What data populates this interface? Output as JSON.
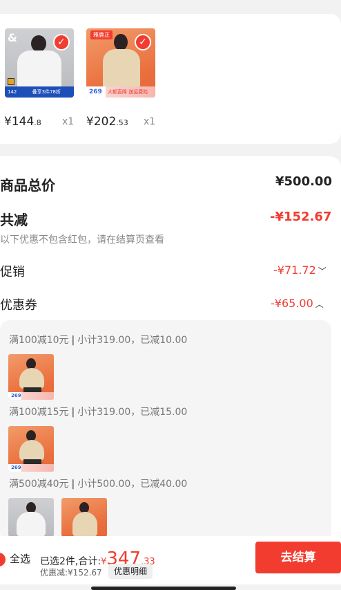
{
  "products": [
    {
      "price_symbol": "¥",
      "price_int": "144",
      "price_dec": ".8",
      "qty": "x1",
      "brand_mark": "&",
      "promo_price": "142",
      "promo_text": "叠享3件78折"
    },
    {
      "price_symbol": "¥",
      "price_int": "202",
      "price_dec": ".53",
      "qty": "x1",
      "brand_tag": "雅鹿正",
      "promo_price": "269",
      "promo_text": "大额直降 送运费险"
    }
  ],
  "summary": {
    "total_label": "商品总价",
    "total_value": "¥500.00",
    "reduce_label": "共减",
    "reduce_value": "-¥152.67",
    "reduce_note": "以下优惠不包含红包，请在结算页查看",
    "promo_label": "促销",
    "promo_value": "-¥71.72",
    "promo_chevron": "﹀",
    "coupon_label": "优惠券",
    "coupon_value": "-¥65.00",
    "coupon_chevron": "︿"
  },
  "coupons": [
    {
      "rule": "满100减10元",
      "detail": "小计319.00，已减10.00",
      "thumb_price": "269"
    },
    {
      "rule": "满100减15元",
      "detail": "小计319.00，已减15.00",
      "thumb_price": "269"
    },
    {
      "rule": "满500减40元",
      "detail": "小计500.00，已减40.00",
      "thumb_price": ""
    }
  ],
  "bottom_bar": {
    "select_all": "全选",
    "selected_text": "已选2件,合计:",
    "total_symbol": "¥",
    "total_int": "347",
    "total_dec": ".33",
    "discount_text": "优惠减:¥152.67",
    "detail_button": "优惠明细",
    "checkout_button": "去结算"
  },
  "colors": {
    "accent_red": "#f23c30",
    "background": "#f2f2f2"
  }
}
